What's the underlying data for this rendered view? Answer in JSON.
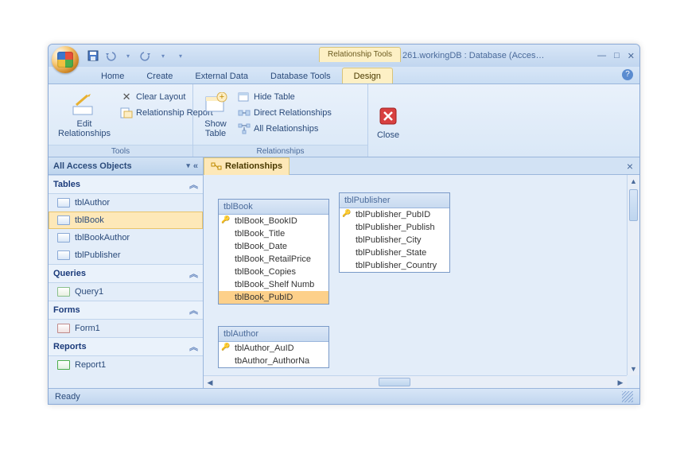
{
  "title_context": "Relationship Tools",
  "doc_title": "261.workingDB : Database (Acces…",
  "tabs": {
    "home": "Home",
    "create": "Create",
    "external": "External Data",
    "dbtools": "Database Tools",
    "design": "Design"
  },
  "ribbon": {
    "edit_relationships": "Edit\nRelationships",
    "clear_layout": "Clear Layout",
    "relationship_report": "Relationship Report",
    "tools_label": "Tools",
    "show_table": "Show\nTable",
    "hide_table": "Hide Table",
    "direct_rel": "Direct Relationships",
    "all_rel": "All Relationships",
    "close": "Close",
    "rel_label": "Relationships"
  },
  "nav": {
    "title": "All Access Objects",
    "groups": {
      "tables": "Tables",
      "queries": "Queries",
      "forms": "Forms",
      "reports": "Reports"
    },
    "tables": [
      "tblAuthor",
      "tblBook",
      "tblBookAuthor",
      "tblPublisher"
    ],
    "selected_table": "tblBook",
    "queries": [
      "Query1"
    ],
    "forms": [
      "Form1"
    ],
    "reports": [
      "Report1"
    ]
  },
  "doctab": "Relationships",
  "tblBook": {
    "title": "tblBook",
    "fields": [
      "tblBook_BookID",
      "tblBook_Title",
      "tblBook_Date",
      "tblBook_RetailPrice",
      "tblBook_Copies",
      "tblBook_Shelf Numb",
      "tblBook_PubID"
    ],
    "key_index": 0,
    "sel_index": 6
  },
  "tblPublisher": {
    "title": "tblPublisher",
    "fields": [
      "tblPublisher_PubID",
      "tblPublisher_Publish",
      "tblPublisher_City",
      "tblPublisher_State",
      "tblPublisher_Country"
    ],
    "key_index": 0
  },
  "tblAuthor": {
    "title": "tblAuthor",
    "fields": [
      "tblAuthor_AuID",
      "tbAuthor_AuthorNa"
    ],
    "key_index": 0
  },
  "status": "Ready"
}
